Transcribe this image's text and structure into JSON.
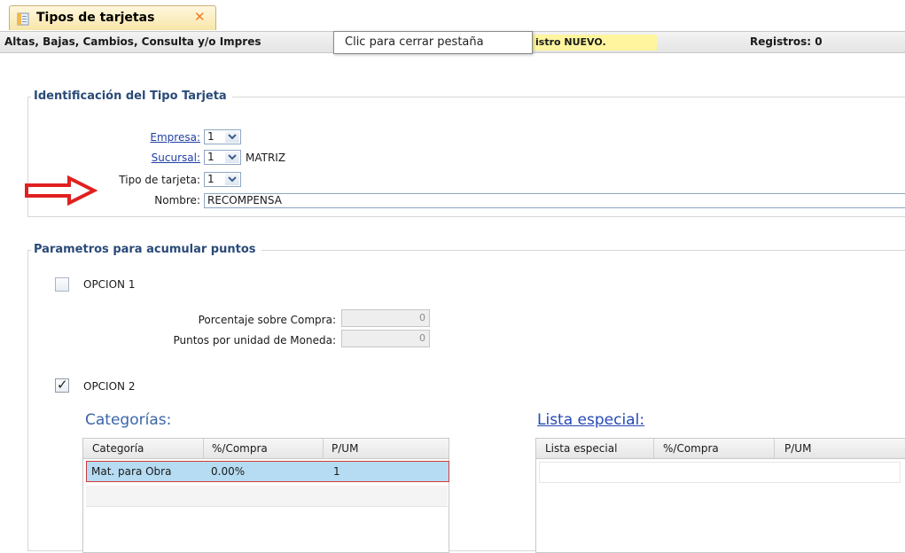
{
  "tab": {
    "title": "Tipos de tarjetas",
    "close_glyph": "✕",
    "icon": "document-icon"
  },
  "tooltip": {
    "text": "Clic para cerrar pestaña"
  },
  "status": {
    "mode_text": "Altas, Bajas, Cambios, Consulta y/o Impres",
    "badge_text": "istro NUEVO.",
    "records_text": "Registros: 0"
  },
  "identificacion": {
    "legend": "Identificación del Tipo Tarjeta",
    "empresa": {
      "label": "Empresa:",
      "value": "1"
    },
    "sucursal": {
      "label": "Sucursal:",
      "value": "1",
      "desc": "MATRIZ"
    },
    "tipo_tarjeta": {
      "label": "Tipo de tarjeta:",
      "value": "1"
    },
    "nombre": {
      "label": "Nombre:",
      "value": "RECOMPENSA"
    }
  },
  "parametros": {
    "legend": "Parametros para acumular puntos",
    "opcion1": {
      "label": "OPCION 1",
      "checked": false,
      "porcentaje": {
        "label": "Porcentaje sobre Compra:",
        "value": "0"
      },
      "puntos": {
        "label": "Puntos por unidad de Moneda:",
        "value": "0"
      }
    },
    "opcion2": {
      "label": "OPCION 2",
      "checked": true,
      "check_glyph": "✓"
    }
  },
  "categorias": {
    "title": "Categorías:",
    "headers": [
      "Categoría",
      "%/Compra",
      "P/UM"
    ],
    "rows": [
      {
        "categoria": "Mat. para Obra",
        "compra": "0.00%",
        "pum": "1"
      }
    ]
  },
  "lista_especial": {
    "title": "Lista especial:",
    "headers": [
      "Lista especial",
      "%/Compra",
      "P/UM"
    ],
    "rows": []
  },
  "colors": {
    "accent_red": "#e02020",
    "tab_close": "#f07a2a",
    "badge_yellow": "#fef59e",
    "selection": "#b6dcf3"
  }
}
